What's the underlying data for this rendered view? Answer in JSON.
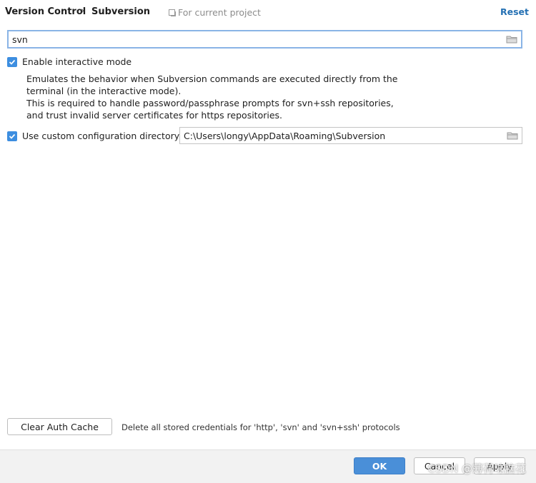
{
  "header": {
    "breadcrumb_root": "Version Control",
    "breadcrumb_separator": "›",
    "breadcrumb_current": "Subversion",
    "scope_label": "For current project",
    "reset_label": "Reset"
  },
  "search": {
    "value": "svn"
  },
  "interactive_mode": {
    "label": "Enable interactive mode",
    "checked": true,
    "description": [
      "Emulates the behavior when Subversion commands are executed directly from the",
      "terminal (in the interactive mode).",
      "This is required to handle password/passphrase prompts for svn+ssh repositories,",
      "and trust invalid server certificates for https repositories."
    ]
  },
  "config_dir": {
    "label": "Use custom configuration directory:",
    "checked": true,
    "value": "C:\\Users\\longy\\AppData\\Roaming\\Subversion"
  },
  "auth_cache": {
    "button_label": "Clear Auth Cache",
    "note": "Delete all stored credentials for 'http', 'svn' and 'svn+ssh' protocols"
  },
  "footer": {
    "ok_label": "OK",
    "cancel_label": "Cancel",
    "apply_label": "Apply"
  },
  "watermark": "CSDN @薄荷味脑花",
  "colors": {
    "accent": "#3d8ee0",
    "link": "#2470b3",
    "primary_button": "#4a8fd8",
    "focus_border": "#8ab4e6"
  },
  "icons": [
    "folder-icon",
    "checkmark-icon",
    "scope-icon",
    "chevron-right-icon"
  ]
}
